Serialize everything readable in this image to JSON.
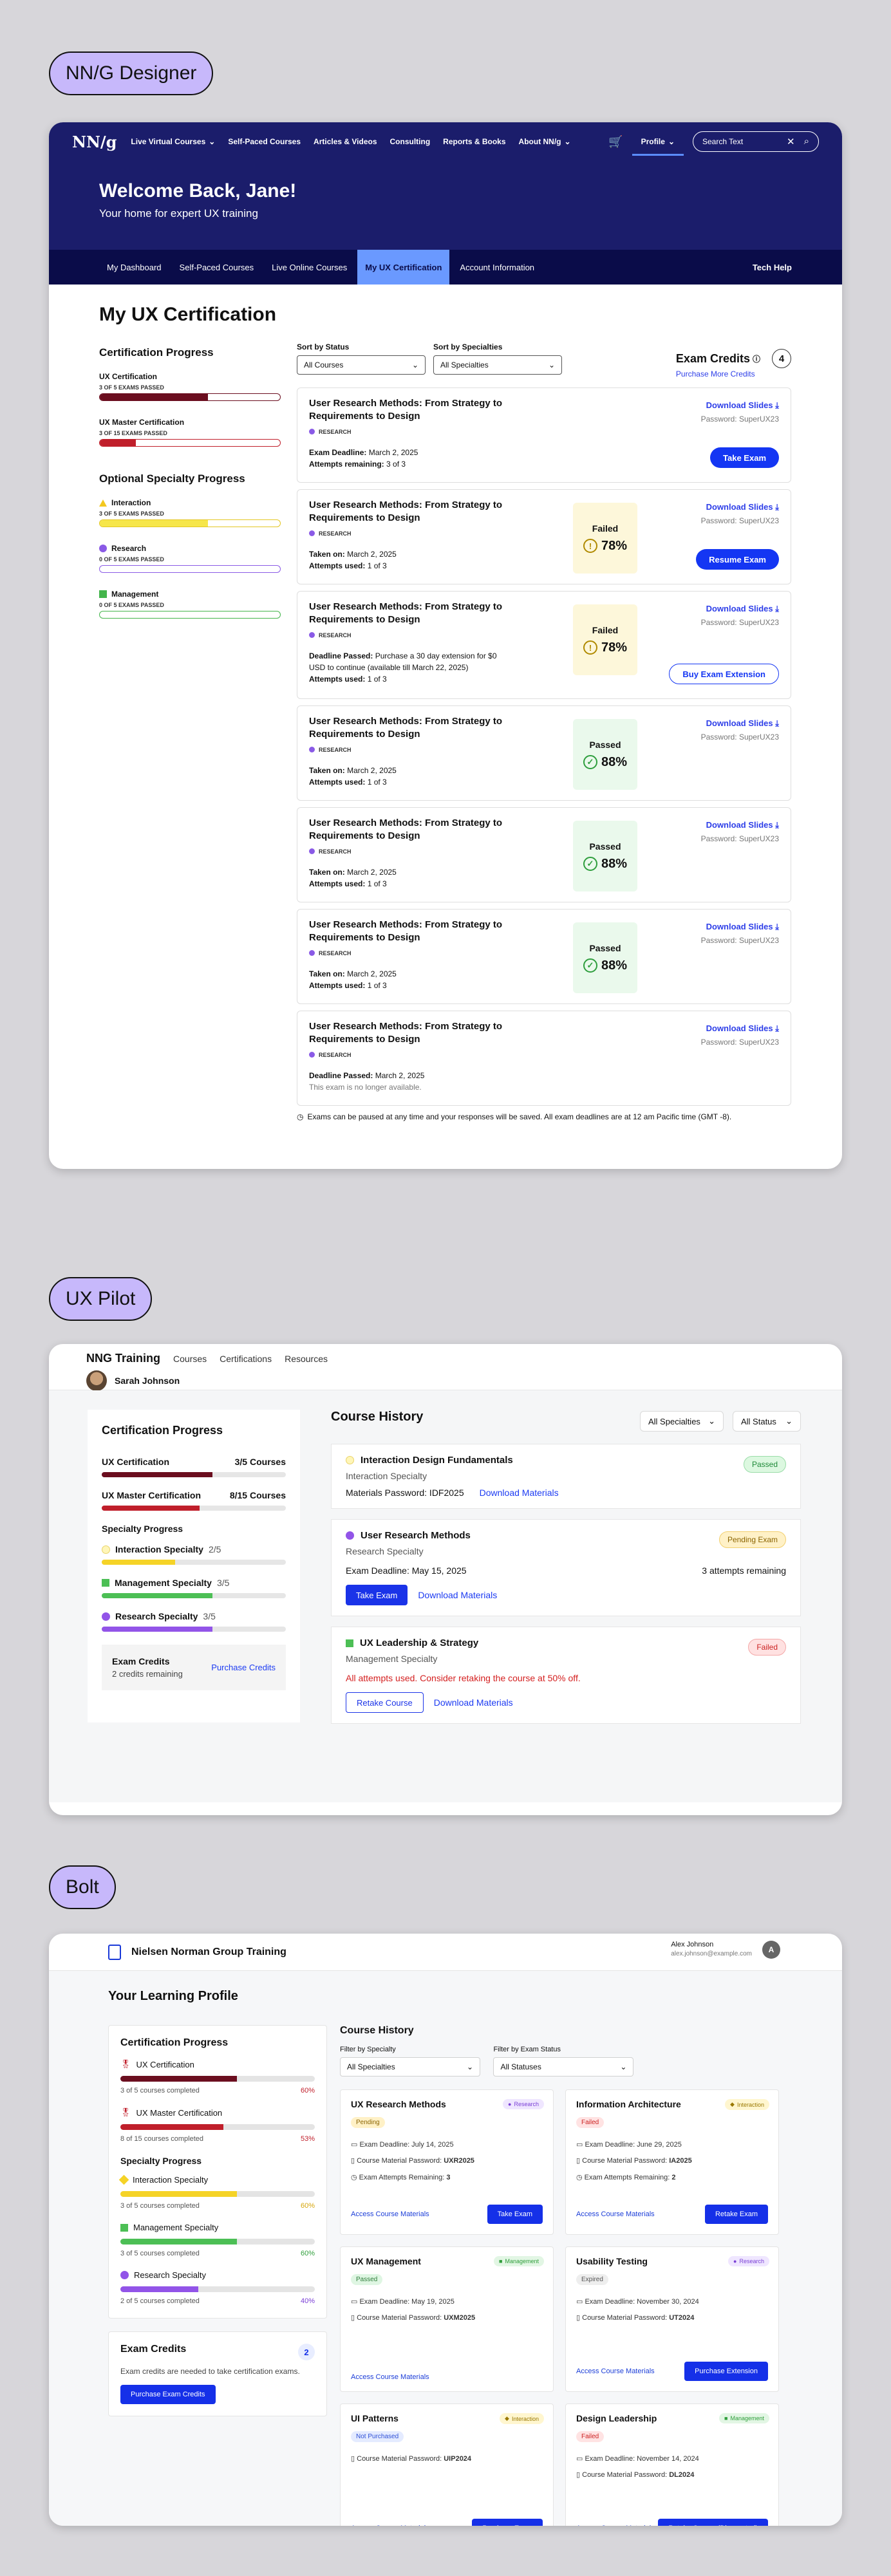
{
  "labels": {
    "nng": "NN/G Designer",
    "uxpilot": "UX Pilot",
    "bolt": "Bolt"
  },
  "nng": {
    "logo": "NN/g",
    "nav": [
      "Live Virtual Courses",
      "Self-Paced Courses",
      "Articles & Videos",
      "Consulting",
      "Reports & Books",
      "About NN/g"
    ],
    "profile": "Profile",
    "search_placeholder": "Search Text",
    "hero_title": "Welcome Back, Jane!",
    "hero_sub": "Your home for expert UX training",
    "subnav": [
      "My Dashboard",
      "Self-Paced Courses",
      "Live Online Courses",
      "My UX Certification",
      "Account Information"
    ],
    "tech_help": "Tech Help",
    "page_title": "My UX Certification",
    "cert_progress_title": "Certification Progress",
    "certs": [
      {
        "name": "UX Certification",
        "status": "3 OF 5 EXAMS PASSED",
        "fill": 60,
        "color": "#6b0e1f",
        "border": "#6b0e1f"
      },
      {
        "name": "UX Master Certification",
        "status": "3 OF 15 EXAMS PASSED",
        "fill": 20,
        "color": "#c01f2b",
        "border": "#c01f2b"
      }
    ],
    "specialty_title": "Optional Specialty Progress",
    "specialties": [
      {
        "name": "Interaction",
        "status": "3 OF 5 EXAMS PASSED",
        "fill": 60,
        "color": "#f6e64a",
        "border": "#e3c622"
      },
      {
        "name": "Research",
        "status": "0 OF 5 EXAMS PASSED",
        "fill": 0,
        "color": "#8a5ae6",
        "border": "#8a5ae6"
      },
      {
        "name": "Management",
        "status": "0 OF 5 EXAMS PASSED",
        "fill": 0,
        "color": "#43b54b",
        "border": "#43b54b"
      }
    ],
    "filter_status_label": "Sort by Status",
    "filter_status_value": "All Courses",
    "filter_spec_label": "Sort by Specialties",
    "filter_spec_value": "All Specialties",
    "credits_title": "Exam Credits",
    "credits_count": "4",
    "credits_link": "Purchase More Credits",
    "exams": [
      {
        "title": "User Research Methods: From Strategy to Requirements to Design",
        "tag": "RESEARCH",
        "l1k": "Exam Deadline:",
        "l1v": "March 2, 2025",
        "l2k": "Attempts remaining:",
        "l2v": "3 of 3",
        "score": "",
        "pct": "",
        "btn": "Take Exam",
        "btnStyle": "solid"
      },
      {
        "title": "User Research Methods: From Strategy to Requirements to Design",
        "tag": "RESEARCH",
        "l1k": "Taken on:",
        "l1v": "March 2, 2025",
        "l2k": "Attempts used:",
        "l2v": "1 of 3",
        "score": "Failed",
        "pct": "78%",
        "btn": "Resume Exam",
        "btnStyle": "solid"
      },
      {
        "title": "User Research Methods: From Strategy to Requirements to Design",
        "tag": "RESEARCH",
        "l1k": "Deadline Passed:",
        "l1v": "Purchase a 30 day extension for $0 USD to continue (available till March 22, 2025)",
        "l2k": "Attempts used:",
        "l2v": "1 of 3",
        "score": "Failed",
        "pct": "78%",
        "btn": "Buy Exam Extension",
        "btnStyle": "outline"
      },
      {
        "title": "User Research Methods: From Strategy to Requirements to Design",
        "tag": "RESEARCH",
        "l1k": "Taken on:",
        "l1v": "March 2, 2025",
        "l2k": "Attempts used:",
        "l2v": "1 of 3",
        "score": "Passed",
        "pct": "88%",
        "btn": "",
        "btnStyle": ""
      },
      {
        "title": "User Research Methods: From Strategy to Requirements to Design",
        "tag": "RESEARCH",
        "l1k": "Taken on:",
        "l1v": "March 2, 2025",
        "l2k": "Attempts used:",
        "l2v": "1 of 3",
        "score": "Passed",
        "pct": "88%",
        "btn": "",
        "btnStyle": ""
      },
      {
        "title": "User Research Methods: From Strategy to Requirements to Design",
        "tag": "RESEARCH",
        "l1k": "Taken on:",
        "l1v": "March 2, 2025",
        "l2k": "Attempts used:",
        "l2v": "1 of 3",
        "score": "Passed",
        "pct": "88%",
        "btn": "",
        "btnStyle": ""
      },
      {
        "title": "User Research Methods: From Strategy to Requirements to Design",
        "tag": "RESEARCH",
        "l1k": "Deadline Passed:",
        "l1v": "March 2, 2025",
        "l2k": "",
        "l2v": "This exam is no longer available.",
        "score": "",
        "pct": "",
        "btn": "",
        "btnStyle": ""
      }
    ],
    "download": "Download Slides",
    "password": "Password: SuperUX23",
    "note": "Exams can be paused at any time and your responses will be saved. All exam deadlines are at 12 am Pacific time (GMT -8)."
  },
  "uxp": {
    "brand": "NNG Training",
    "nav": [
      "Courses",
      "Certifications",
      "Resources"
    ],
    "user": "Sarah Johnson",
    "left_title": "Certification Progress",
    "certs": [
      {
        "name": "UX Certification",
        "count": "3/5 Courses",
        "fill": 60,
        "color": "#6b0e1f"
      },
      {
        "name": "UX Master Certification",
        "count": "8/15 Courses",
        "fill": 53,
        "color": "#c01f2b"
      }
    ],
    "spec_title": "Specialty Progress",
    "specs": [
      {
        "name": "Interaction Specialty",
        "count": "2/5",
        "fill": 40,
        "color": "#f5d327"
      },
      {
        "name": "Management Specialty",
        "count": "3/5",
        "fill": 60,
        "color": "#4cbf55"
      },
      {
        "name": "Research Specialty",
        "count": "3/5",
        "fill": 60,
        "color": "#9254e8"
      }
    ],
    "credits_title": "Exam Credits",
    "credits_sub": "2 credits remaining",
    "credits_link": "Purchase Credits",
    "history_title": "Course History",
    "sel1": "All Specialties",
    "sel2": "All Status",
    "cards": [
      {
        "title": "Interaction Design Fundamentals",
        "sub": "Interaction Specialty",
        "badge": "Passed",
        "line": "Materials Password: IDF2025",
        "link": "Download Materials",
        "extra": ""
      },
      {
        "title": "User Research Methods",
        "sub": "Research Specialty",
        "badge": "Pending Exam",
        "line": "Exam Deadline: May 15, 2025",
        "extra": "3 attempts remaining",
        "btn": "Take Exam",
        "link": "Download Materials"
      },
      {
        "title": "UX Leadership & Strategy",
        "sub": "Management Specialty",
        "badge": "Failed",
        "line": "All attempts used. Consider retaking the course at 50% off.",
        "btn": "Retake Course",
        "link": "Download Materials",
        "extra": ""
      }
    ]
  },
  "bolt": {
    "brand": "Nielsen Norman Group Training",
    "user_name": "Alex Johnson",
    "user_email": "alex.johnson@example.com",
    "avatar": "A",
    "title": "Your Learning Profile",
    "cert_title": "Certification Progress",
    "certs": [
      {
        "name": "UX Certification",
        "done": "3 of 5 courses completed",
        "pct": "60%",
        "fill": 60,
        "color": "#6b0e1f",
        "pctColor": "#c01f2b"
      },
      {
        "name": "UX Master Certification",
        "done": "8 of 15 courses completed",
        "pct": "53%",
        "fill": 53,
        "color": "#c01f2b",
        "pctColor": "#c01f2b"
      }
    ],
    "spec_title": "Specialty Progress",
    "specs": [
      {
        "name": "Interaction Specialty",
        "done": "3 of 5 courses completed",
        "pct": "60%",
        "fill": 60,
        "color": "#f5d327",
        "pctColor": "#d6a60b"
      },
      {
        "name": "Management Specialty",
        "done": "3 of 5 courses completed",
        "pct": "60%",
        "fill": 60,
        "color": "#4cbf55",
        "pctColor": "#2f9e3b"
      },
      {
        "name": "Research Specialty",
        "done": "2 of 5 courses completed",
        "pct": "40%",
        "fill": 40,
        "color": "#9254e8",
        "pctColor": "#7a3fd6"
      }
    ],
    "credits_title": "Exam Credits",
    "credits_count": "2",
    "credits_desc": "Exam credits are needed to take certification exams.",
    "credits_btn": "Purchase Exam Credits",
    "history_title": "Course History",
    "filter1_label": "Filter by Specialty",
    "filter1_value": "All Specialties",
    "filter2_label": "Filter by Exam Status",
    "filter2_value": "All Statuses",
    "link": "Access Course Materials",
    "cards": [
      {
        "title": "UX Research Methods",
        "spec": "Research",
        "status": "Pending",
        "r1": "Exam Deadline: July 14, 2025",
        "r2k": "Course Material Password: ",
        "r2v": "UXR2025",
        "r3k": "Exam Attempts Remaining: ",
        "r3v": "3",
        "btn": "Take Exam"
      },
      {
        "title": "Information Architecture",
        "spec": "Interaction",
        "status": "Failed",
        "r1": "Exam Deadline: June 29, 2025",
        "r2k": "Course Material Password: ",
        "r2v": "IA2025",
        "r3k": "Exam Attempts Remaining: ",
        "r3v": "2",
        "btn": "Retake Exam"
      },
      {
        "title": "UX Management",
        "spec": "Management",
        "status": "Passed",
        "r1": "Exam Deadline: May 19, 2025",
        "r2k": "Course Material Password: ",
        "r2v": "UXM2025",
        "r3k": "",
        "r3v": "",
        "btn": ""
      },
      {
        "title": "Usability Testing",
        "spec": "Research",
        "status": "Expired",
        "r1": "Exam Deadline: November 30, 2024",
        "r2k": "Course Material Password: ",
        "r2v": "UT2024",
        "r3k": "",
        "r3v": "",
        "btn": "Purchase Extension"
      },
      {
        "title": "UI Patterns",
        "spec": "Interaction",
        "status": "Not Purchased",
        "r1": "",
        "r2k": "Course Material Password: ",
        "r2v": "UIP2024",
        "r3k": "",
        "r3v": "",
        "btn": "Purchase Exam"
      },
      {
        "title": "Design Leadership",
        "spec": "Management",
        "status": "Failed",
        "r1": "Exam Deadline: November 14, 2024",
        "r2k": "Course Material Password: ",
        "r2v": "DL2024",
        "r3k": "",
        "r3v": "",
        "btn": "Retake Course (Discounted)"
      }
    ]
  }
}
